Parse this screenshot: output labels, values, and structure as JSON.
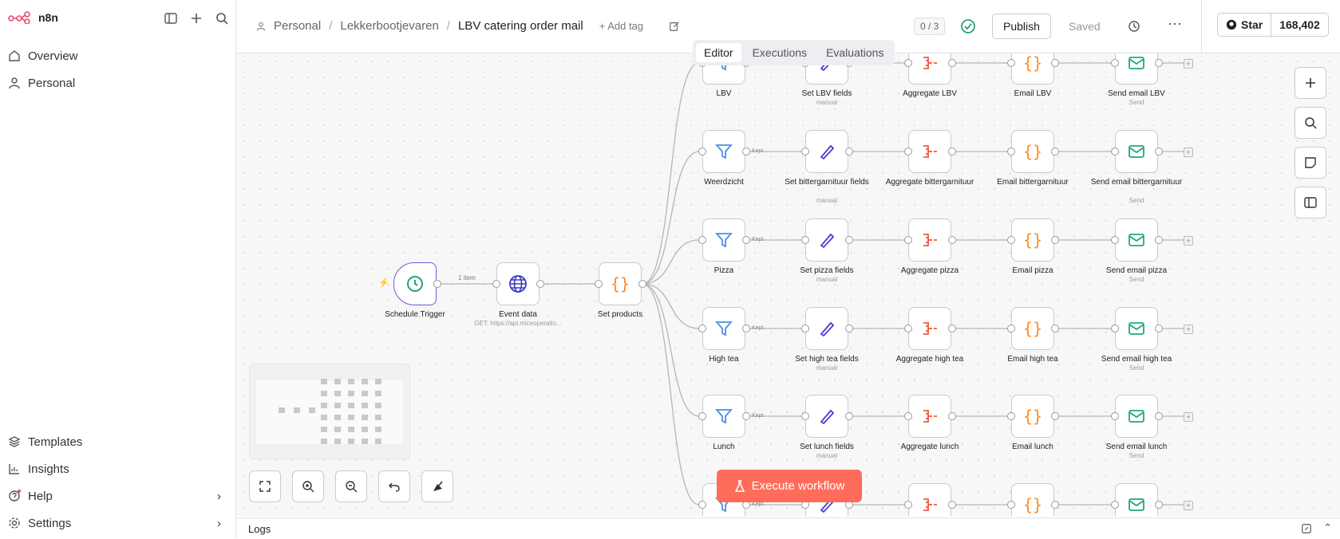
{
  "brand": "n8n",
  "sidebar": {
    "overview": "Overview",
    "personal": "Personal",
    "templates": "Templates",
    "insights": "Insights",
    "help": "Help",
    "settings": "Settings"
  },
  "breadcrumb": {
    "project": "Personal",
    "folder": "Lekkerbootjevaren",
    "workflow": "LBV catering order mail",
    "add_tag": "+ Add tag"
  },
  "toolbar": {
    "progress": "0 / 3",
    "publish": "Publish",
    "saved": "Saved",
    "star": "Star",
    "star_count": "168,402"
  },
  "tabs": [
    "Editor",
    "Executions",
    "Evaluations"
  ],
  "main_nodes": {
    "trigger": "Schedule Trigger",
    "event": "Event data",
    "event_sub": "GET: https://api.miceoperatio...",
    "set_products": "Set products",
    "items_label": "1 item"
  },
  "rows": [
    {
      "filter": "LBV",
      "set": "Set LBV fields",
      "aggregate": "Aggregate LBV",
      "email_code": "Email LBV",
      "send": "Send email LBV"
    },
    {
      "filter": "Weerdzicht",
      "set": "Set bittergarnituur fields",
      "aggregate": "Aggregate bittergarnituur",
      "email_code": "Email bittergarnituur",
      "send": "Send email bittergarnituur"
    },
    {
      "filter": "Pizza",
      "set": "Set pizza fields",
      "aggregate": "Aggregate pizza",
      "email_code": "Email pizza",
      "send": "Send email pizza"
    },
    {
      "filter": "High tea",
      "set": "Set high tea fields",
      "aggregate": "Aggregate high tea",
      "email_code": "Email high tea",
      "send": "Send email high tea"
    },
    {
      "filter": "Lunch",
      "set": "Set lunch fields",
      "aggregate": "Aggregate lunch",
      "email_code": "Email lunch",
      "send": "Send email lunch"
    },
    {
      "filter": "",
      "set": "",
      "aggregate": "",
      "email_code": "",
      "send": ""
    }
  ],
  "sub_labels": {
    "manual": "manual",
    "send": "Send",
    "kept": "Kept"
  },
  "execute": "Execute workflow",
  "logs": "Logs"
}
